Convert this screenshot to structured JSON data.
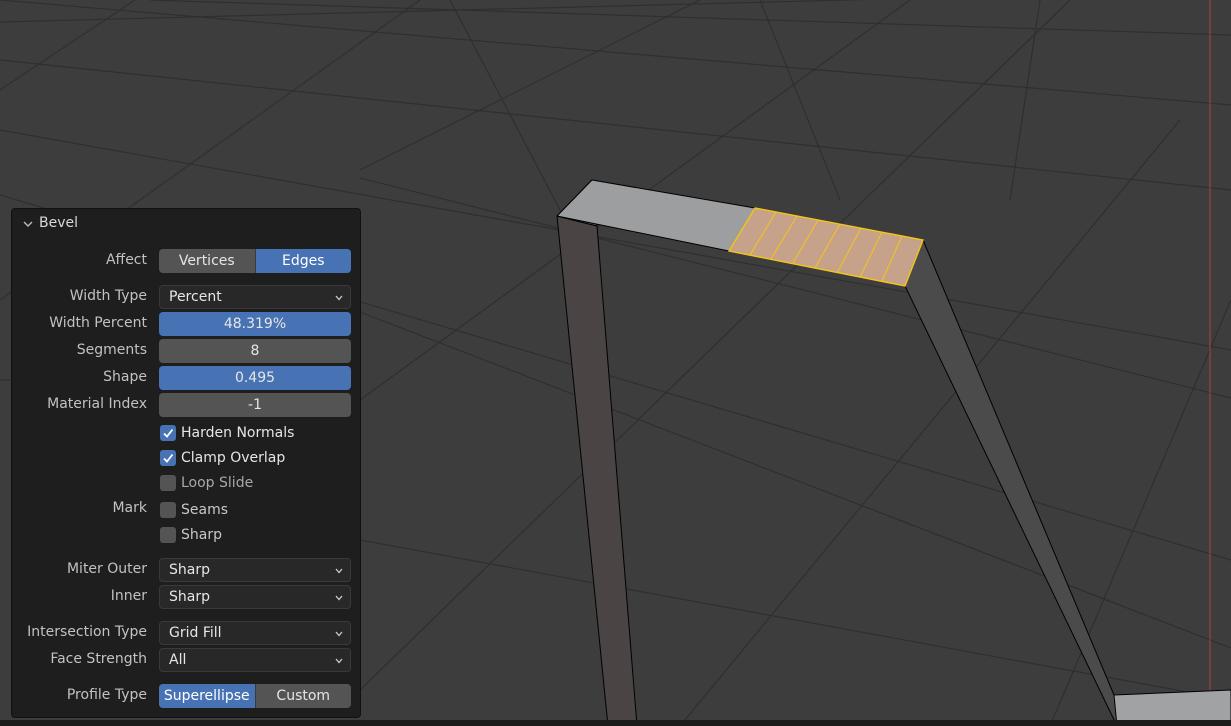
{
  "panel": {
    "title": "Bevel",
    "affect": {
      "label": "Affect",
      "options": [
        "Vertices",
        "Edges"
      ],
      "selected": "Edges"
    },
    "width_type": {
      "label": "Width Type",
      "value": "Percent"
    },
    "width_percent": {
      "label": "Width Percent",
      "value": "48.319%"
    },
    "segments": {
      "label": "Segments",
      "value": "8"
    },
    "shape": {
      "label": "Shape",
      "value": "0.495"
    },
    "material_index": {
      "label": "Material Index",
      "value": "-1"
    },
    "harden_normals": {
      "label": "Harden Normals",
      "checked": true
    },
    "clamp_overlap": {
      "label": "Clamp Overlap",
      "checked": true
    },
    "loop_slide": {
      "label": "Loop Slide",
      "checked": false
    },
    "mark": {
      "label": "Mark",
      "seams": {
        "label": "Seams",
        "checked": false
      },
      "sharp": {
        "label": "Sharp",
        "checked": false
      }
    },
    "miter_outer": {
      "label": "Miter Outer",
      "value": "Sharp"
    },
    "inner": {
      "label": "Inner",
      "value": "Sharp"
    },
    "intersection_type": {
      "label": "Intersection Type",
      "value": "Grid Fill"
    },
    "face_strength": {
      "label": "Face Strength",
      "value": "All"
    },
    "profile_type": {
      "label": "Profile Type",
      "options": [
        "Superellipse",
        "Custom"
      ],
      "selected": "Superellipse"
    }
  },
  "colors": {
    "viewport_bg": "#3d3d3d",
    "grid_line": "#2e2e2e",
    "mesh_top": "#9b9d9f",
    "mesh_side": "#4a4a4a",
    "selection_face": "#c9a38a",
    "selection_edge": "#f5c518",
    "accent": "#4772b3",
    "axis_red": "#b84040"
  },
  "icons": [
    "chevron-down-icon",
    "checkmark-icon"
  ]
}
